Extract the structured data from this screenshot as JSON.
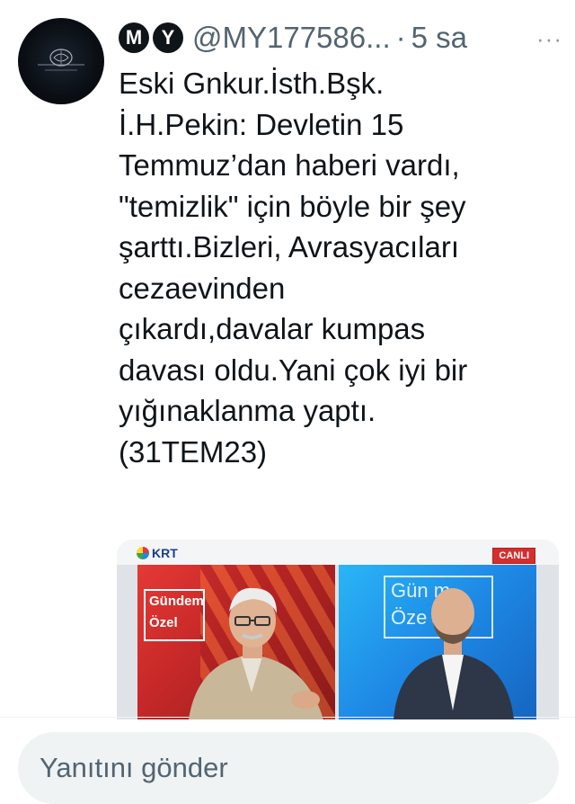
{
  "tweet": {
    "display_name_badges": [
      "M",
      "Y"
    ],
    "handle": "@MY177586...",
    "separator": "·",
    "time": "5 sa",
    "more_label": "···",
    "text": "Eski Gnkur.İsth.Bşk.\nİ.H.Pekin: Devletin 15\nTemmuz’dan haberi vardı,\n\"temizlik\" için böyle bir şey\nşarttı.Bizleri, Avrasyacıları\ncezaevinden\nçıkardı,davalar kumpas\ndavası oldu.Yani çok iyi bir\nyığınaklanma yaptı.\n(31TEM23)"
  },
  "media": {
    "channel_logo": "KRT",
    "live_badge": "CANLI",
    "show_name_left": [
      "Gündem",
      "Özel"
    ],
    "show_name_right": [
      "Gün  m",
      "Öze"
    ]
  },
  "reply": {
    "placeholder": "Yanıtını gönder"
  },
  "colors": {
    "text_primary": "#0f1419",
    "text_secondary": "#536471",
    "reply_bg": "#eff3f4",
    "live_red": "#d32f2f"
  }
}
